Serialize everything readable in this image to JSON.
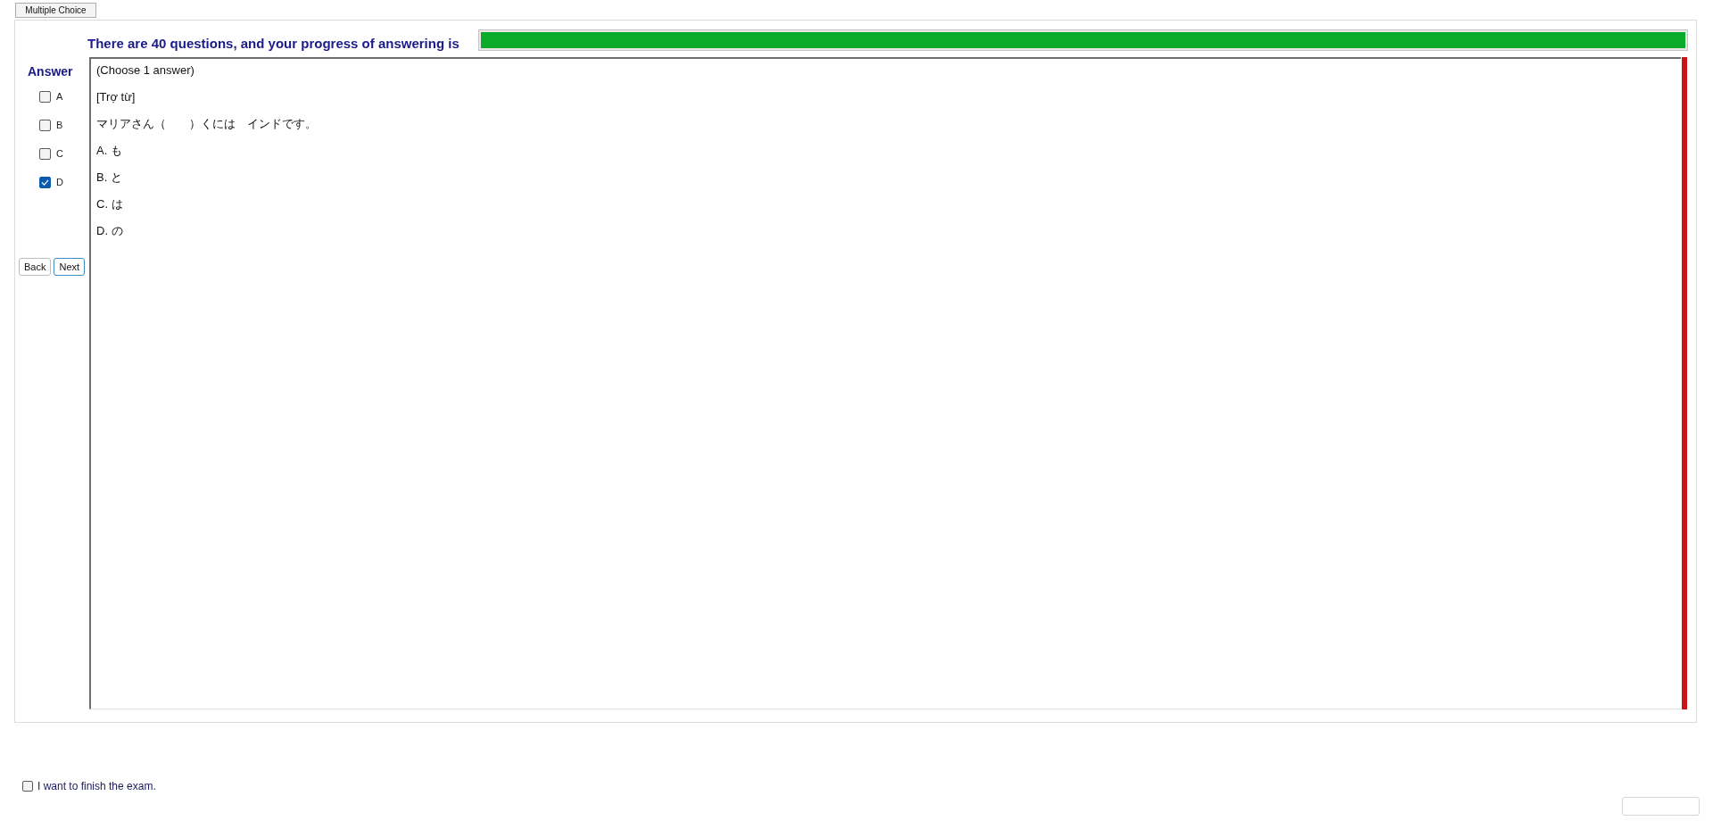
{
  "tabs": [
    {
      "label": "Multiple Choice",
      "selected": true
    }
  ],
  "header": {
    "text": "There are 40 questions, and your progress of answering is",
    "progress": {
      "level": 1
    }
  },
  "answer_panel": {
    "title": "Answer",
    "options": [
      {
        "label": "A",
        "checked": false
      },
      {
        "label": "B",
        "checked": false
      },
      {
        "label": "C",
        "checked": false
      },
      {
        "label": "D",
        "checked": true
      }
    ],
    "buttons": [
      {
        "label": "Back",
        "focused": false
      },
      {
        "label": "Next",
        "focused": true
      }
    ]
  },
  "question": {
    "lines": [
      "(Choose 1 answer)",
      "[Trợ từ]",
      "マリアさん（　　）くには　インドです。",
      "A. も",
      "B. と",
      "C. は",
      "D. の"
    ]
  },
  "finish": {
    "label": "I want to finish the exam.",
    "checked": false
  }
}
